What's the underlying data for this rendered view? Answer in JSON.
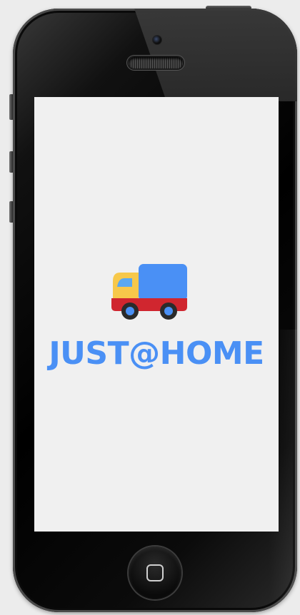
{
  "app": {
    "brand_text": "JUST@HOME",
    "logo_icon": "delivery-truck-icon",
    "brand_color": "#4a90f5",
    "screen_background": "#f0f0f0"
  },
  "colors": {
    "truck_cargo": "#4a90f5",
    "truck_cab": "#f7c84a",
    "truck_window": "#5aa8f0",
    "truck_base": "#d0262f",
    "wheel": "#2b2b2b",
    "hubcap": "#4a90f5"
  },
  "device": {
    "home_button_icon": "home-square-icon"
  }
}
